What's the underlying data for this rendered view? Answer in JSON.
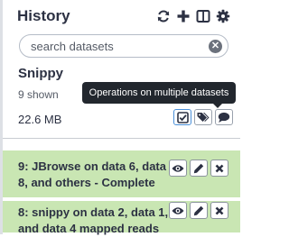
{
  "header": {
    "title": "History",
    "icons": [
      "refresh-icon",
      "plus-icon",
      "columns-icon",
      "gear-icon"
    ]
  },
  "search": {
    "placeholder": "search datasets",
    "value": ""
  },
  "history": {
    "name": "Snippy",
    "shown": "9 shown",
    "size": "22.6 MB"
  },
  "tooltip": {
    "text": "Operations on multiple datasets"
  },
  "multi_buttons": [
    "check-square-icon",
    "tags-icon",
    "comment-icon"
  ],
  "datasets": [
    {
      "title": "9: JBrowse on data 6, data 8, and others - Complete",
      "state_color": "#c9e6b3"
    },
    {
      "title": "8: snippy on data 2, data 1, and data 4 mapped reads",
      "state_color": "#c9e6b3"
    }
  ],
  "colors": {
    "ok_dataset": "#c9e6b3",
    "tooltip_bg": "#22272e",
    "text": "#2c3143"
  }
}
